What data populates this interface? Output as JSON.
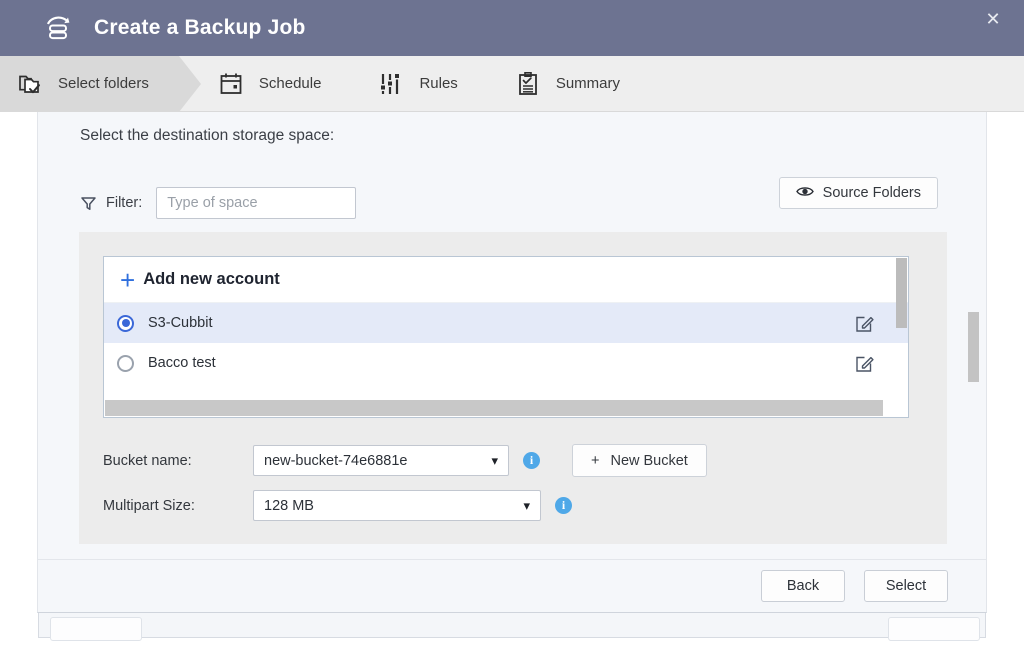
{
  "window": {
    "title": "Create a Backup Job",
    "title_icon": "backup-server-icon",
    "close_label": "✕",
    "accent_titlebar": "#6d7391"
  },
  "steps": [
    {
      "label": "Select folders",
      "icon": "folder-check-icon",
      "active": true
    },
    {
      "label": "Schedule",
      "icon": "calendar-icon",
      "active": false
    },
    {
      "label": "Rules",
      "icon": "sliders-icon",
      "active": false
    },
    {
      "label": "Summary",
      "icon": "clipboard-check-icon",
      "active": false
    }
  ],
  "main": {
    "section_title": "Select the destination storage space:",
    "filter": {
      "icon": "funnel-icon",
      "label": "Filter:",
      "value": "",
      "placeholder": "Type of space"
    },
    "source_folders_button": {
      "label": "Source Folders",
      "icon": "eye-icon"
    },
    "account_list": {
      "add_new": {
        "label": "Add new account",
        "icon": "plus-icon",
        "color": "#2f6fdd"
      },
      "accounts": [
        {
          "name": "S3-Cubbit",
          "selected": true,
          "edit_icon": "edit-pencil-icon"
        },
        {
          "name": "Bacco test",
          "selected": false,
          "edit_icon": "edit-pencil-icon"
        }
      ]
    },
    "bucket": {
      "label": "Bucket name:",
      "value": "new-bucket-74e6881e",
      "info_icon": "info-icon",
      "new_bucket_button": {
        "label": "New Bucket",
        "icon": "plus-icon"
      }
    },
    "multipart": {
      "label": "Multipart Size:",
      "value": "128 MB",
      "info_icon": "info-icon"
    }
  },
  "footer": {
    "back_label": "Back",
    "select_label": "Select"
  }
}
